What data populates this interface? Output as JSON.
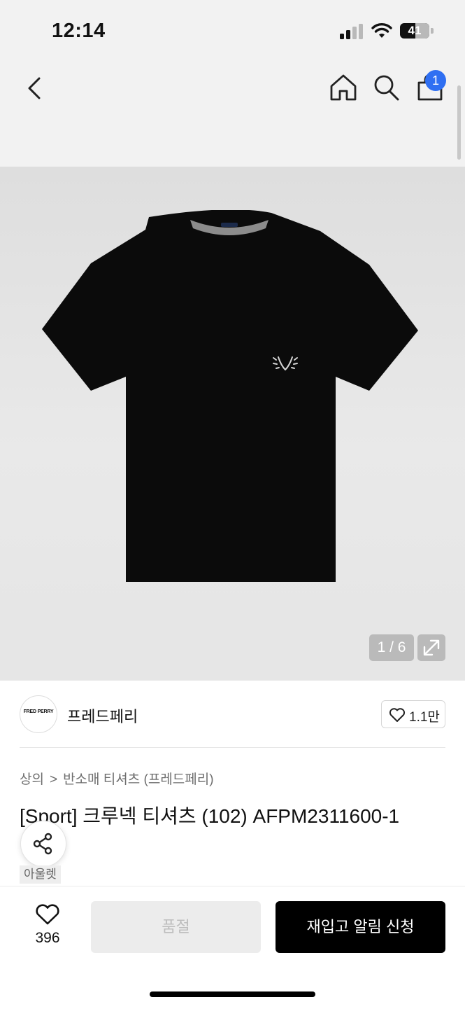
{
  "status_bar": {
    "time": "12:14",
    "battery": "41"
  },
  "header": {
    "cart_count": "1"
  },
  "gallery": {
    "counter": "1 / 6"
  },
  "brand": {
    "logo_text": "FRED PERRY",
    "name": "프레드페리",
    "likes": "1.1만"
  },
  "breadcrumb": {
    "items": [
      "상의",
      "반소매 티셔츠 (프레드페리)"
    ],
    "separator": ">"
  },
  "product": {
    "title": "[Sport] 크루넥 티셔츠 (102) AFPM2311600-1",
    "tag": "아울렛"
  },
  "bottom_bar": {
    "wish_count": "396",
    "soldout_label": "품절",
    "restock_label": "재입고 알림 신청"
  },
  "colors": {
    "accent_badge": "#2f6ff2",
    "primary_button": "#000000",
    "disabled_button": "#ececec"
  },
  "icons": [
    "back-icon",
    "home-icon",
    "search-icon",
    "bag-icon",
    "expand-icon",
    "heart-icon",
    "share-icon"
  ]
}
